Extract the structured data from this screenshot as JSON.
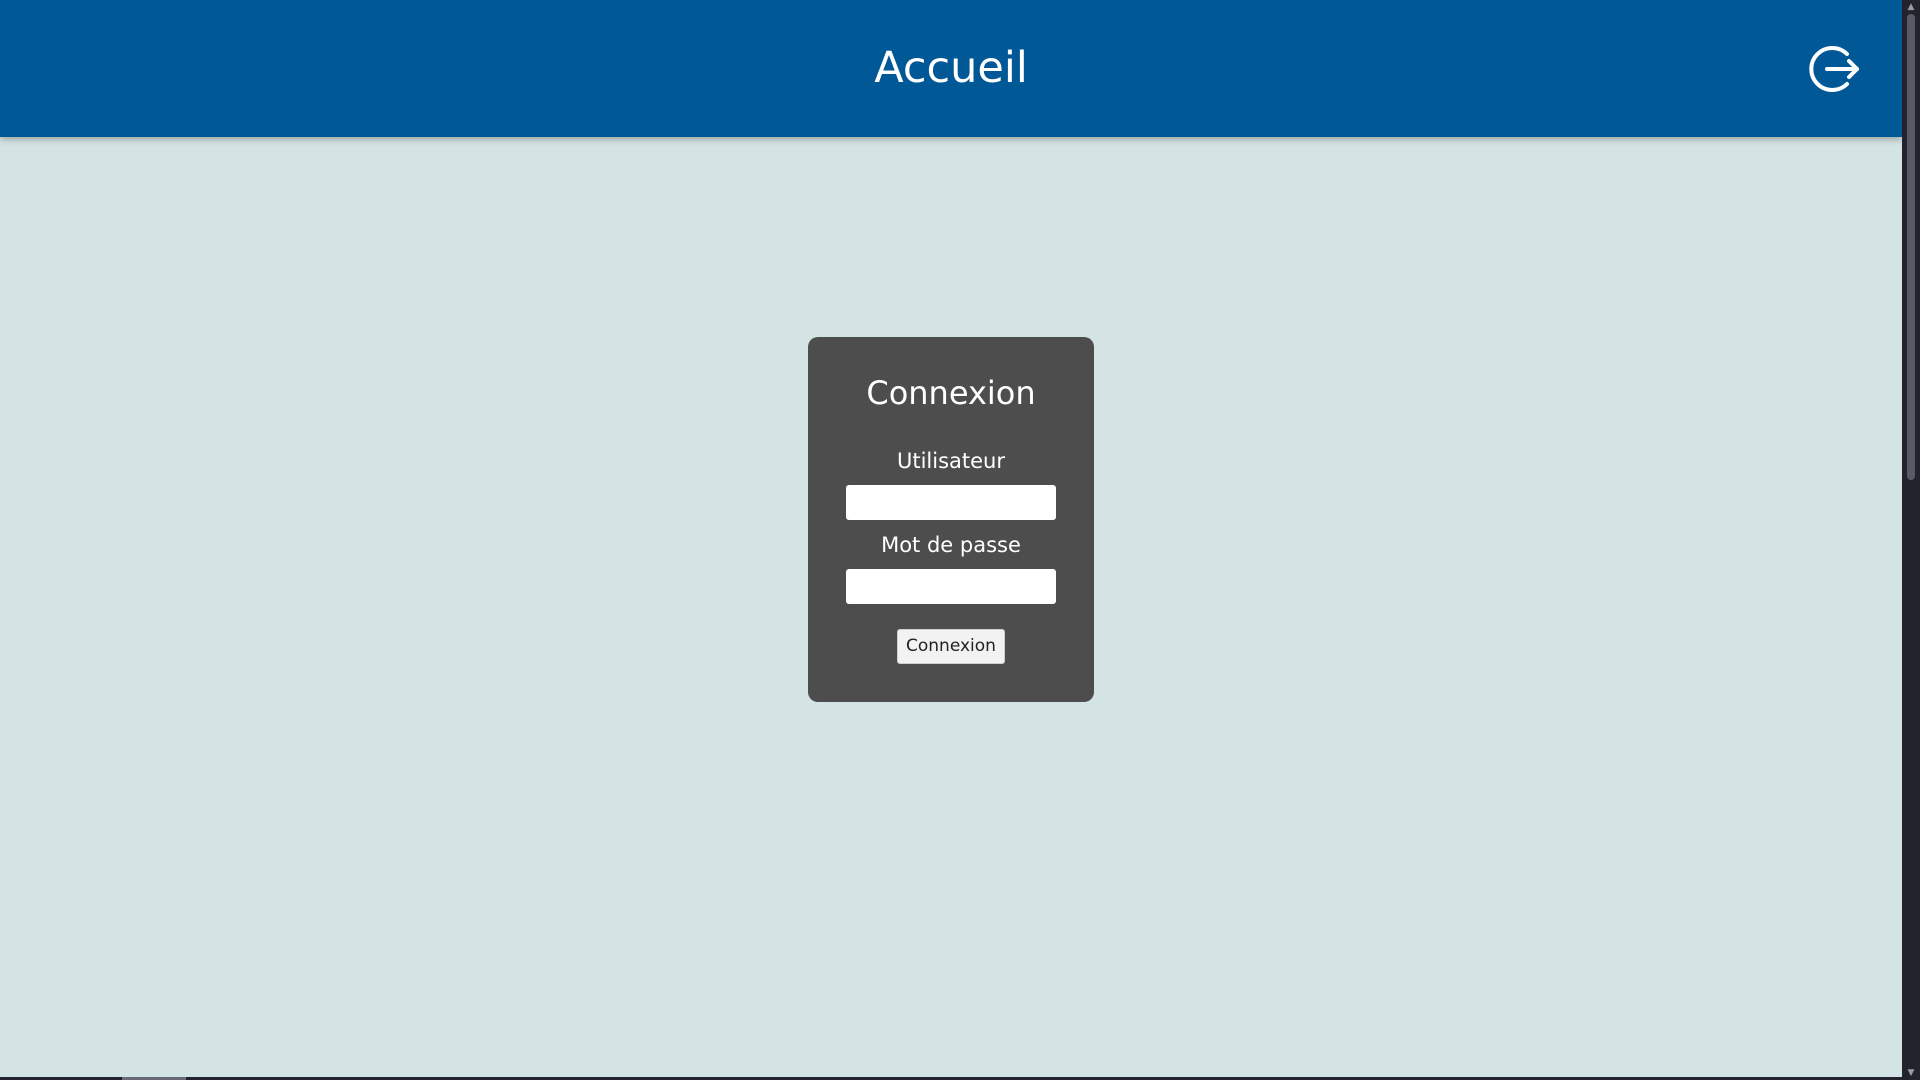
{
  "header": {
    "title": "Accueil",
    "logout_icon": "logout-icon"
  },
  "login": {
    "title": "Connexion",
    "username_label": "Utilisateur",
    "username_value": "",
    "password_label": "Mot de passe",
    "password_value": "",
    "submit_label": "Connexion"
  },
  "scrollbar": {
    "up_icon": "▲",
    "down_icon": "▼"
  },
  "colors": {
    "header_bg": "#005896",
    "page_bg": "#d4e4e4",
    "card_bg": "#4d4d4d",
    "text_light": "#ffffff"
  }
}
